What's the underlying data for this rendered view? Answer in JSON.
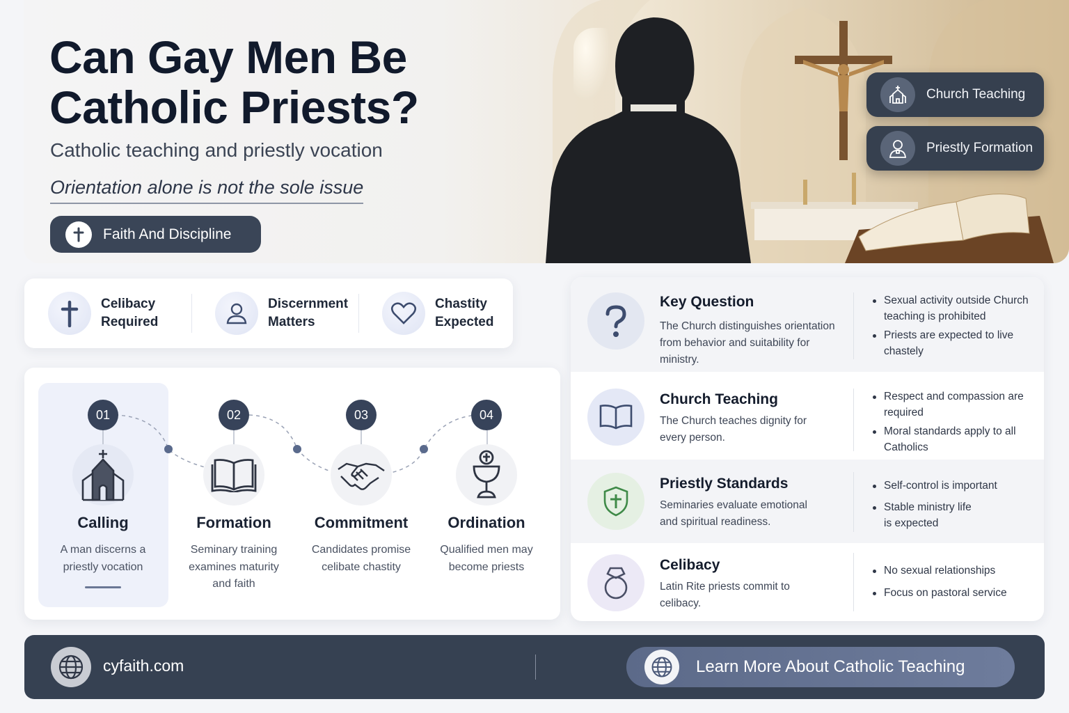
{
  "hero": {
    "title": "Can Gay Men Be Catholic Priests?",
    "subtitle": "Catholic teaching and priestly vocation",
    "tagline": "Orientation alone is not the sole issue",
    "pill_label": "Faith And Discipline",
    "tags": [
      {
        "label": "Church Teaching",
        "icon": "church-icon"
      },
      {
        "label": "Priestly Formation",
        "icon": "priest-icon"
      }
    ]
  },
  "facts": [
    {
      "label": "Celibacy Required",
      "icon": "cross-icon"
    },
    {
      "label": "Discernment Matters",
      "icon": "person-icon"
    },
    {
      "label": "Chastity Expected",
      "icon": "heart-icon"
    }
  ],
  "steps": [
    {
      "num": "01",
      "title": "Calling",
      "desc": "A man discerns a priestly vocation",
      "icon": "church-icon"
    },
    {
      "num": "02",
      "title": "Formation",
      "desc": "Seminary training examines maturity and faith",
      "icon": "book-icon"
    },
    {
      "num": "03",
      "title": "Commitment",
      "desc": "Candidates promise celibate chastity",
      "icon": "handshake-icon"
    },
    {
      "num": "04",
      "title": "Ordination",
      "desc": "Qualified men may become priests",
      "icon": "chalice-icon"
    }
  ],
  "panel": [
    {
      "title": "Key Question",
      "desc": "The Church distinguishes orientation from behavior and suitability for ministry.",
      "icon": "question-icon",
      "bullets": [
        "Sexual activity outside Church teaching is prohibited",
        "Priests are expected to live chastely"
      ]
    },
    {
      "title": "Church Teaching",
      "desc": "The Church teaches dignity for every person.",
      "icon": "book-icon",
      "bullets": [
        "Respect and compassion are required",
        "Moral standards apply to all Catholics"
      ]
    },
    {
      "title": "Priestly Standards",
      "desc": "Seminaries evaluate emotional and spiritual readiness.",
      "icon": "shield-cross-icon",
      "bullets": [
        "Self-control is important",
        "Stable ministry life is expected"
      ]
    },
    {
      "title": "Celibacy",
      "desc": "Latin Rite priests commit to celibacy.",
      "icon": "ring-icon",
      "bullets": [
        "No sexual relationships",
        "Focus on pastoral service"
      ]
    }
  ],
  "footer": {
    "site": "cyfaith.com",
    "cta": "Learn More About Catholic Teaching"
  },
  "colors": {
    "navy": "#364152",
    "accent": "#5c6a89",
    "green": "#3f8a48"
  }
}
